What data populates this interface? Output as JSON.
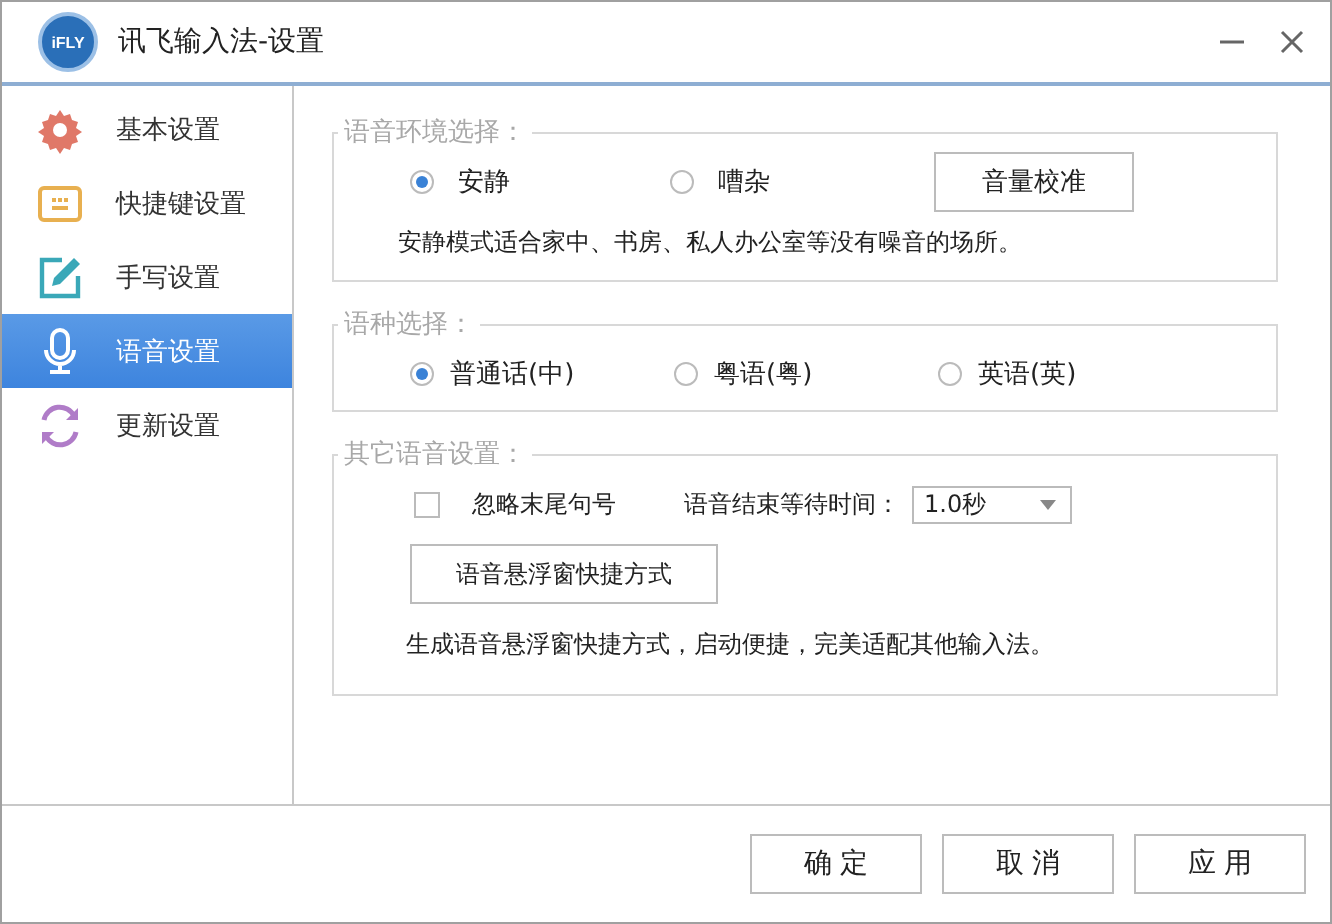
{
  "window": {
    "logo": "iFLY",
    "title": "讯飞输入法-设置"
  },
  "sidebar": {
    "items": [
      {
        "kind": "gear",
        "label": "基本设置",
        "selected": false
      },
      {
        "kind": "keyboard",
        "label": "快捷键设置",
        "selected": false
      },
      {
        "kind": "pen",
        "label": "手写设置",
        "selected": false
      },
      {
        "kind": "mic",
        "label": "语音设置",
        "selected": true
      },
      {
        "kind": "refresh",
        "label": "更新设置",
        "selected": false
      }
    ]
  },
  "environment": {
    "legend": "语音环境选择：",
    "options": [
      {
        "label": "安静",
        "selected": true
      },
      {
        "label": "嘈杂",
        "selected": false
      }
    ],
    "calibrate_button": "音量校准",
    "description": "安静模式适合家中、书房、私人办公室等没有噪音的场所。"
  },
  "language": {
    "legend": "语种选择：",
    "options": [
      {
        "label": "普通话(中)",
        "selected": true
      },
      {
        "label": "粤语(粤)",
        "selected": false
      },
      {
        "label": "英语(英)",
        "selected": false
      }
    ]
  },
  "other": {
    "legend": "其它语音设置：",
    "ignore_period": {
      "label": "忽略末尾句号",
      "checked": false
    },
    "wait_label": "语音结束等待时间：",
    "wait_value": "1.0秒",
    "shortcut_button": "语音悬浮窗快捷方式",
    "description": "生成语音悬浮窗快捷方式，启动便捷，完美适配其他输入法。"
  },
  "buttons": [
    "确 定",
    "取 消",
    "应 用"
  ]
}
